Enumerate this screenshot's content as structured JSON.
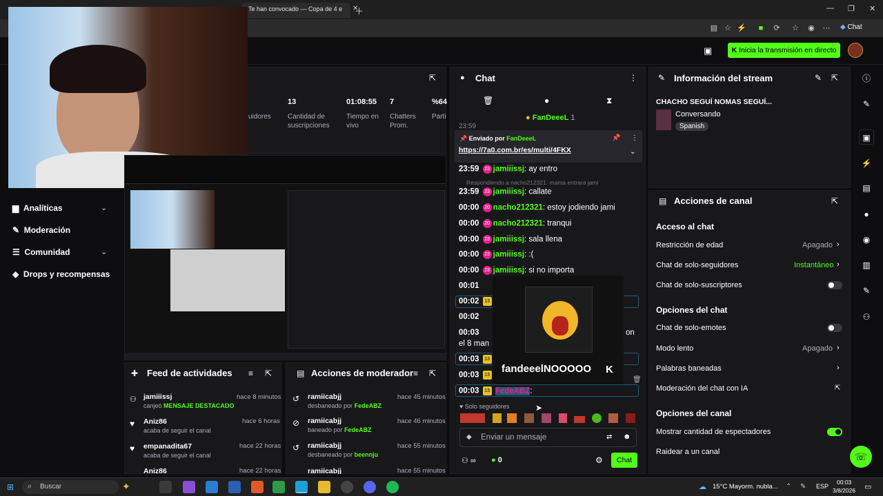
{
  "browser": {
    "tab_title": "Te han convocado — Copa de 4 e",
    "toolbar_right_label": "Chat"
  },
  "header": {
    "go_live_label": "Inicia la transmisión en directo"
  },
  "stats": [
    {
      "value": "13",
      "label": "Cantidad de suscripciones"
    },
    {
      "value": "01:08:55",
      "label": "Tiempo en vivo"
    },
    {
      "value": "7",
      "label": "Chatters Prom."
    },
    {
      "value": "%64",
      "label": "Parti"
    }
  ],
  "stats_partial": {
    "label": "uidores"
  },
  "nav": [
    {
      "label": "Analíticas"
    },
    {
      "label": "Moderación"
    },
    {
      "label": "Comunidad"
    },
    {
      "label": "Drops y recompensas"
    }
  ],
  "chat": {
    "title": "Chat",
    "pinned_user": "FanDeeeL",
    "pinned_count": "1",
    "pinned_by_label": "Enviado por",
    "pinned_by_user": "FanDeeeL",
    "pinned_link": "https://7a0.com.br/es/multi/4FKX",
    "reply_context": "Respondiendo a nacho212321: mama entrara jami",
    "messages": [
      {
        "time": "23:59",
        "badge": "23",
        "user": "jamiiissj",
        "text": "ay entro"
      },
      {
        "time": "23:59",
        "badge": "23",
        "user": "jamiiissj",
        "text": "callate"
      },
      {
        "time": "00:00",
        "badge": "20",
        "user": "nacho212321",
        "text": "estoy jodiendo jami"
      },
      {
        "time": "00:00",
        "badge": "20",
        "user": "nacho212321",
        "text": "tranqui"
      },
      {
        "time": "00:00",
        "badge": "23",
        "user": "jamiiissj",
        "text": "sala llena"
      },
      {
        "time": "00:00",
        "badge": "23",
        "user": "jamiiissj",
        "text": ":("
      },
      {
        "time": "00:00",
        "badge": "23",
        "user": "jamiiissj",
        "text": "si no importa"
      }
    ],
    "partial_times": [
      "00:01",
      "00:02",
      "00:02",
      "00:03",
      "00:03",
      "00:03",
      "00:03"
    ],
    "partial_badges": [
      "13",
      "13",
      "13",
      "13"
    ],
    "partial_fragments": {
      "on": "on",
      "el8": "el 8 man"
    },
    "last_user": "FedeABZ",
    "emote_popup_name": "fandeeelNOOOOO",
    "followers_only": "Solo seguidores",
    "input_placeholder": "Enviar un mensaje",
    "viewers_count": "0",
    "send_label": "Chat"
  },
  "stream_info": {
    "title": "Información del stream",
    "stream_title": "CHACHO SEGUÍ NOMAS SEGUÍ...",
    "category": "Conversando",
    "language": "Spanish"
  },
  "channel_actions": {
    "title": "Acciones de canal",
    "chat_access": "Acceso al chat",
    "age_restriction": "Restricción de edad",
    "age_restriction_value": "Apagado",
    "followers_only": "Chat de solo-seguidores",
    "followers_only_value": "Instantáneo",
    "subs_only": "Chat de solo-suscriptores",
    "chat_options": "Opciones del chat",
    "emotes_only": "Chat de solo-emotes",
    "slow_mode": "Modo lento",
    "slow_mode_value": "Apagado",
    "banned_words": "Palabras baneadas",
    "ai_moderation": "Moderación del chat con IA",
    "channel_options": "Opciones del canal",
    "show_viewers": "Mostrar cantidad de espectadores",
    "raid": "Raidear a un canal"
  },
  "feed": {
    "title": "Feed de actividades",
    "items": [
      {
        "user": "jamiiissj",
        "time": "hace 8 minutos",
        "desc_prefix": "canjeó",
        "desc_highlight": "MENSAJE DESTACADO"
      },
      {
        "user": "Aniz86",
        "time": "hace 6 horas",
        "desc": "acaba de seguir el canal"
      },
      {
        "user": "empanadita67",
        "time": "hace 22 horas",
        "desc": "acaba de seguir el canal"
      },
      {
        "user": "Aniz86",
        "time": "hace 22 horas"
      }
    ]
  },
  "mod": {
    "title": "Acciones de moderador",
    "items": [
      {
        "user": "ramiicabjj",
        "time": "hace 45 minutos",
        "desc": "desbaneado por",
        "by": "FedeABZ"
      },
      {
        "user": "ramiicabjj",
        "time": "hace 46 minutos",
        "desc": "baneado por",
        "by": "FedeABZ"
      },
      {
        "user": "ramiicabjj",
        "time": "hace 55 minutos",
        "desc": "desbaneado por",
        "by": "beennju"
      },
      {
        "user": "ramiicabjj",
        "time": "hace 55 minutos"
      }
    ]
  },
  "taskbar": {
    "search": "Buscar",
    "weather": "15°C  Mayorm. nubla...",
    "lang": "ESP",
    "time": "00:03",
    "date": "3/8/2026"
  },
  "colors": {
    "accent": "#53fc18",
    "bg": "#0e0e10",
    "panel": "#18181b",
    "sub_badge": "#e91e8c"
  }
}
